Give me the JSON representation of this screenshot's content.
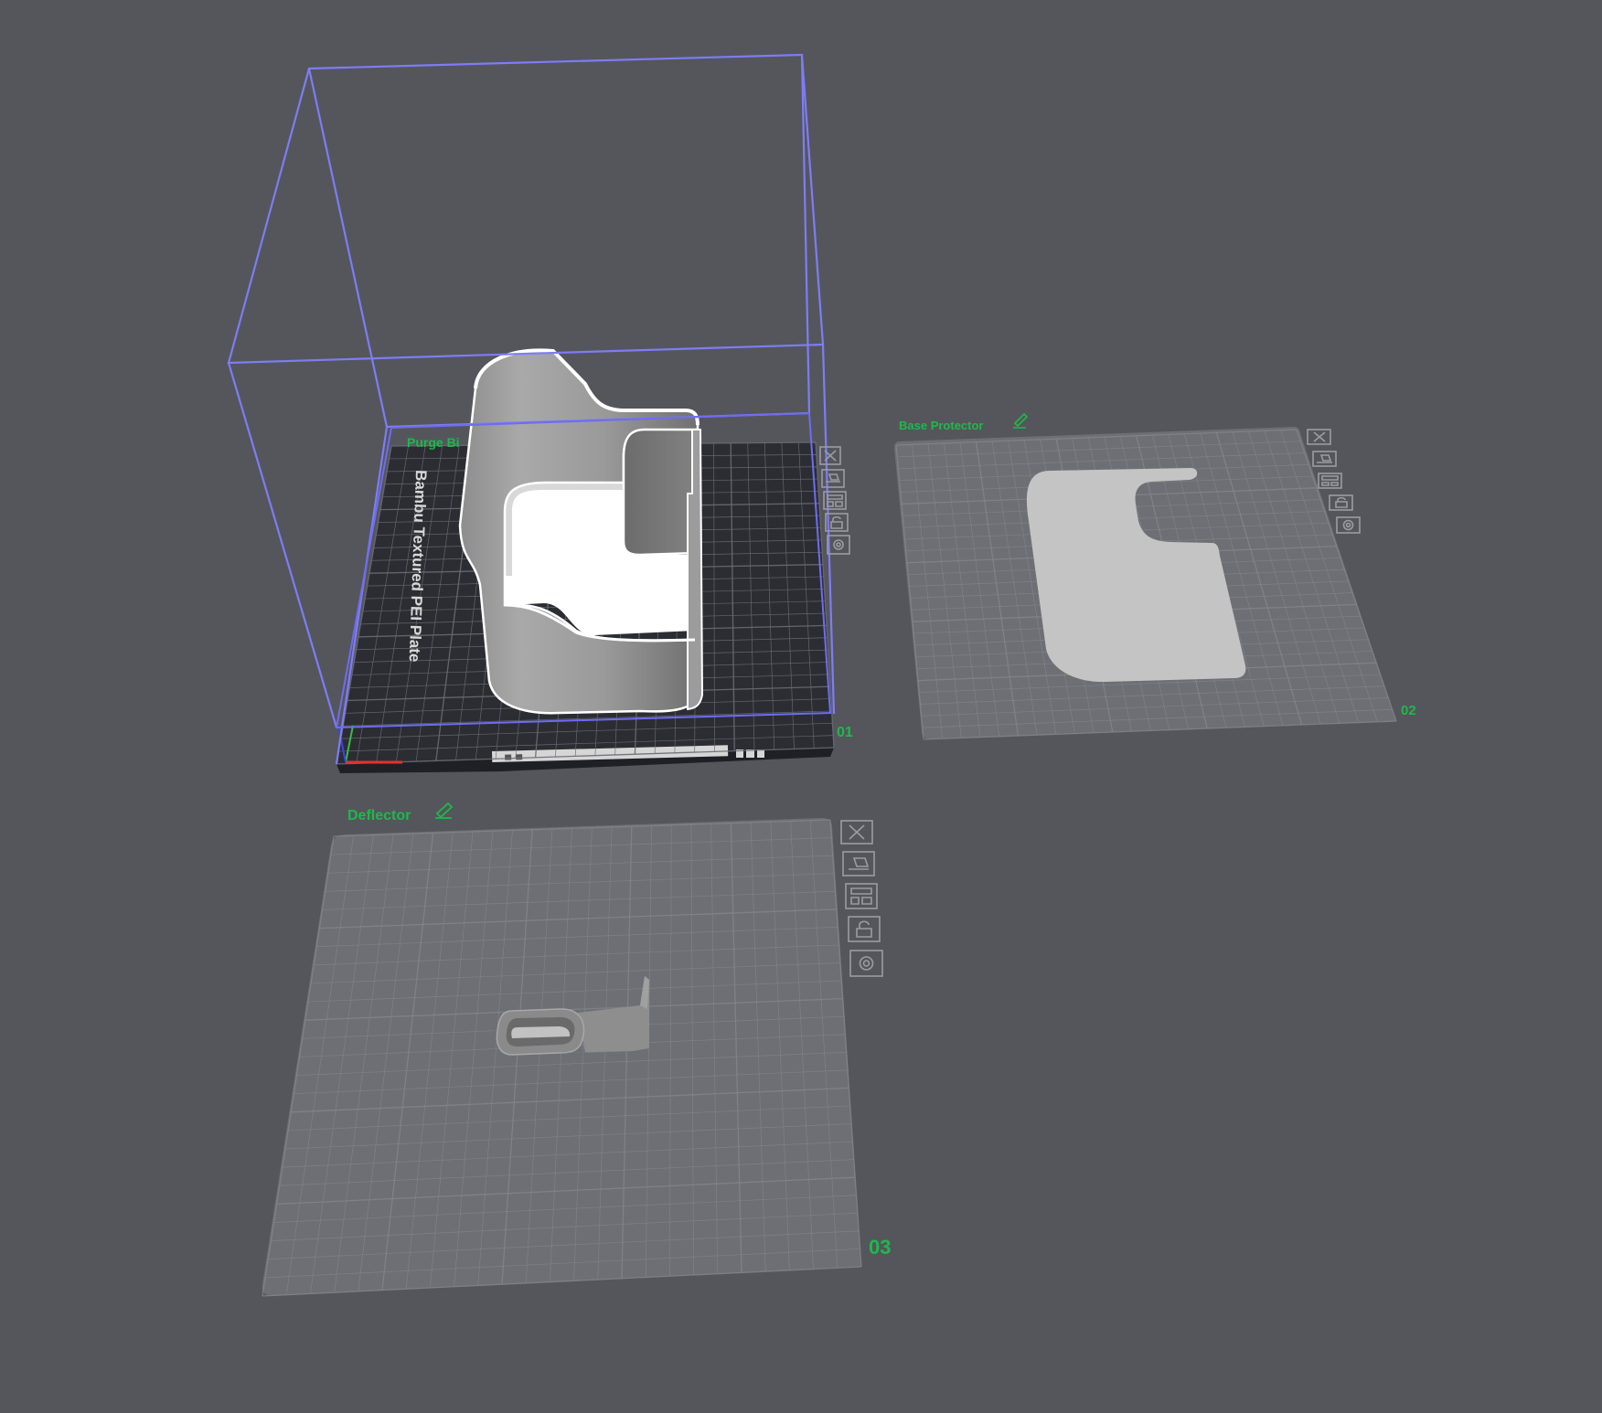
{
  "plates": [
    {
      "number": "01",
      "name": "Purge Bi",
      "bed_type": "Bambu Textured PEI Plate",
      "active": true
    },
    {
      "number": "02",
      "name": "Base Protector",
      "active": false
    },
    {
      "number": "03",
      "name": "Deflector",
      "active": false
    }
  ],
  "plate_toolbar_icons": [
    "close-icon",
    "orient-icon",
    "arrange-icon",
    "lock-icon",
    "settings-icon"
  ],
  "colors": {
    "background": "#54565c",
    "active_bed": "#2c2d33",
    "inactive_bed": "#6d6f75",
    "grid_line": "#85878d",
    "bounding_box": "#7f7cf5",
    "label_green": "#1fb84a",
    "model_light": "#c4c4c4",
    "model_dark": "#7a7a7a"
  }
}
